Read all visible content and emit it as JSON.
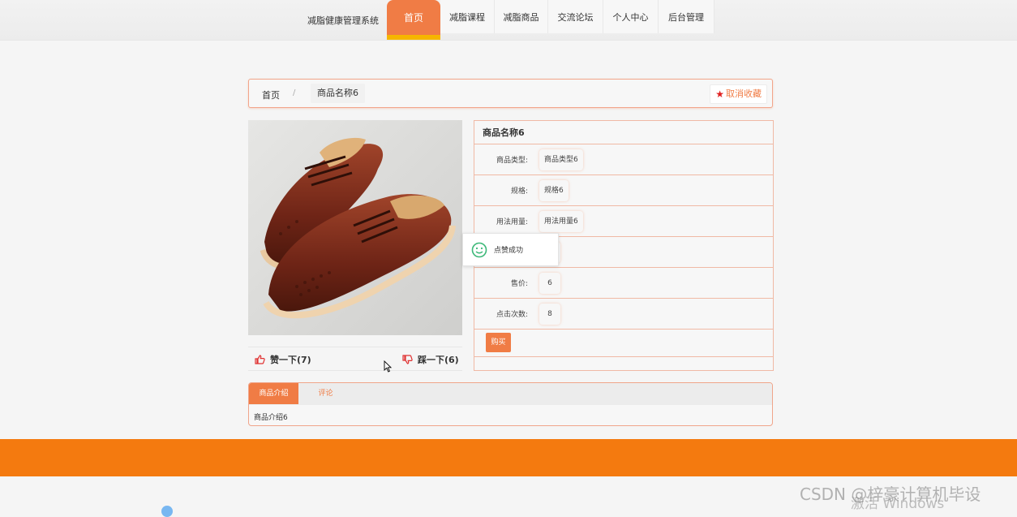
{
  "header": {
    "brand": "减脂健康管理系统",
    "nav": [
      {
        "label": "首页",
        "active": true
      },
      {
        "label": "减脂课程",
        "active": false
      },
      {
        "label": "减脂商品",
        "active": false
      },
      {
        "label": "交流论坛",
        "active": false
      },
      {
        "label": "个人中心",
        "active": false
      },
      {
        "label": "后台管理",
        "active": false
      }
    ]
  },
  "breadcrumb": {
    "home": "首页",
    "separator": "/",
    "current": "商品名称6",
    "favorite_button": "取消收藏"
  },
  "product": {
    "image_icon": "brogue-shoes-photo",
    "name": "商品名称6",
    "fields": [
      {
        "label": "商品类型:",
        "value": "商品类型6"
      },
      {
        "label": "规格:",
        "value": "规格6"
      },
      {
        "label": "用法用量:",
        "value": "用法用量6"
      },
      {
        "label": "",
        "value": ""
      },
      {
        "label": "售价:",
        "value": "6"
      },
      {
        "label": "点击次数:",
        "value": "8"
      }
    ],
    "buy_button": "购买",
    "like": "赞一下(7)",
    "dislike": "踩一下(6)"
  },
  "toast": {
    "text": "点赞成功",
    "icon": "smile-icon"
  },
  "tabs": {
    "items": [
      "商品介绍",
      "评论"
    ],
    "active_index": 0,
    "content": "商品介绍6"
  },
  "overlay": {
    "watermark": "CSDN @梓豪计算机毕设",
    "activate": "激活 Windows"
  },
  "colors": {
    "accent": "#f07c45",
    "footer": "#f47a0f",
    "nav_underline": "#f6b500"
  }
}
